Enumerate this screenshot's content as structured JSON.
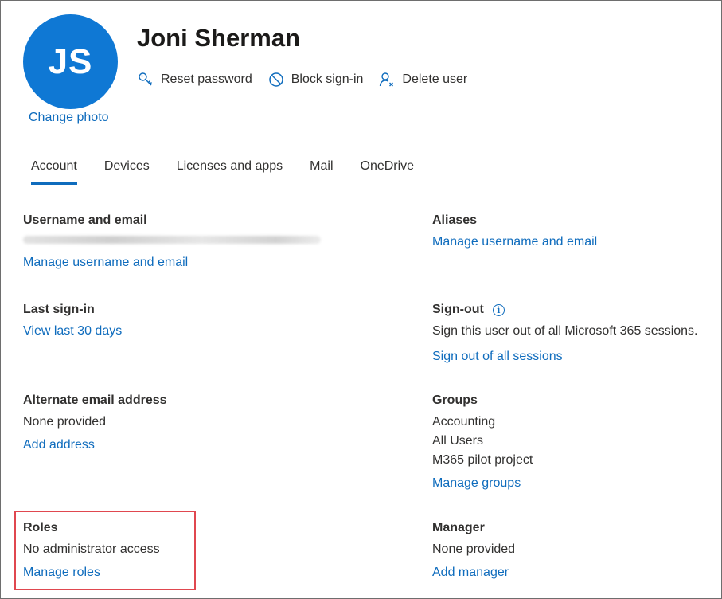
{
  "user": {
    "initials": "JS",
    "name": "Joni Sherman",
    "change_photo": "Change photo",
    "avatar_color": "#0f78d4"
  },
  "actions": [
    {
      "label": "Reset password",
      "icon": "key-icon"
    },
    {
      "label": "Block sign-in",
      "icon": "block-icon"
    },
    {
      "label": "Delete user",
      "icon": "delete-user-icon"
    }
  ],
  "tabs": [
    "Account",
    "Devices",
    "Licenses and apps",
    "Mail",
    "OneDrive"
  ],
  "active_tab": "Account",
  "left": {
    "username": {
      "heading": "Username and email",
      "link": "Manage username and email"
    },
    "last_signin": {
      "heading": "Last sign-in",
      "link": "View last 30 days"
    },
    "alt_email": {
      "heading": "Alternate email address",
      "value": "None provided",
      "link": "Add address"
    },
    "roles": {
      "heading": "Roles",
      "value": "No administrator access",
      "link": "Manage roles"
    }
  },
  "right": {
    "aliases": {
      "heading": "Aliases",
      "link": "Manage username and email"
    },
    "signout": {
      "heading": "Sign-out",
      "text": "Sign this user out of all Microsoft 365 sessions.",
      "link": "Sign out of all sessions"
    },
    "groups": {
      "heading": "Groups",
      "items": [
        "Accounting",
        "All Users",
        "M365 pilot project"
      ],
      "link": "Manage groups"
    },
    "manager": {
      "heading": "Manager",
      "value": "None provided",
      "link": "Add manager"
    }
  },
  "colors": {
    "link": "#0f6cbd",
    "highlight": "#e0474f",
    "tab_underline": "#0f6cbd"
  }
}
